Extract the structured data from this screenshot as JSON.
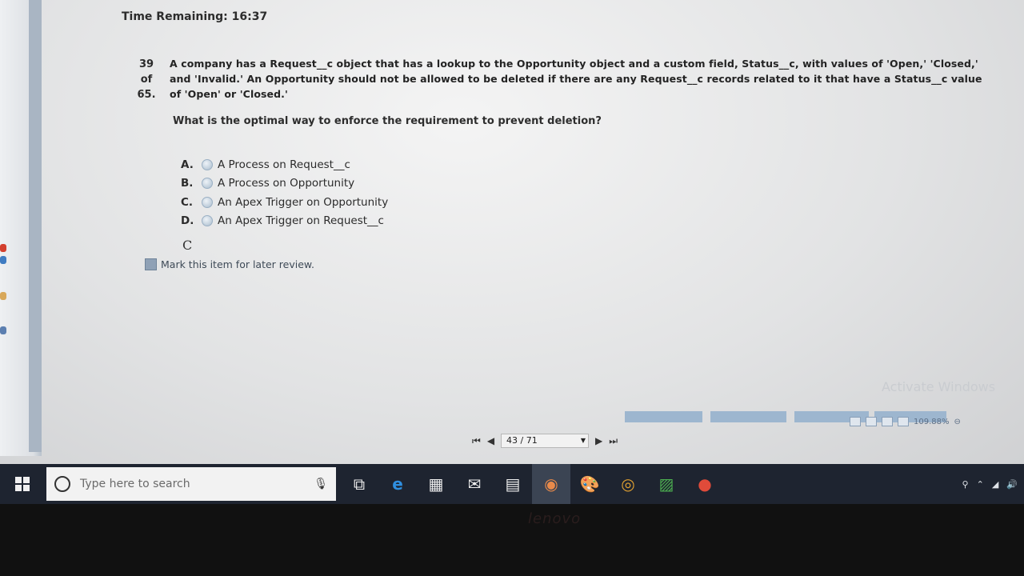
{
  "timer": {
    "label": "Time Remaining: 16:37"
  },
  "question": {
    "number": "39",
    "of": "of",
    "total": "65.",
    "text_lines": [
      "A company has a Request__c object that has a lookup to the Opportunity object and a custom field, Status__c, with values of 'Open,' 'Closed,'",
      "and 'Invalid.' An Opportunity should not be allowed to be deleted if there are any Request__c records related to it that have a Status__c value",
      "of 'Open' or 'Closed.'"
    ],
    "prompt": "What is the optimal way to enforce the requirement to prevent deletion?",
    "options": [
      {
        "letter": "A.",
        "text": "A Process on Request__c"
      },
      {
        "letter": "B.",
        "text": "A Process on Opportunity"
      },
      {
        "letter": "C.",
        "text": "An Apex Trigger on Opportunity"
      },
      {
        "letter": "D.",
        "text": "An Apex Trigger on Request__c"
      }
    ],
    "answer_note": "C",
    "mark_review_label": "Mark this item for later review."
  },
  "watermark": "Activate Windows",
  "pager": {
    "page_label": "43 / 71",
    "zoom": "109.88%"
  },
  "taskbar": {
    "search_placeholder": "Type here to search"
  },
  "bezel_brand": "lenovo"
}
